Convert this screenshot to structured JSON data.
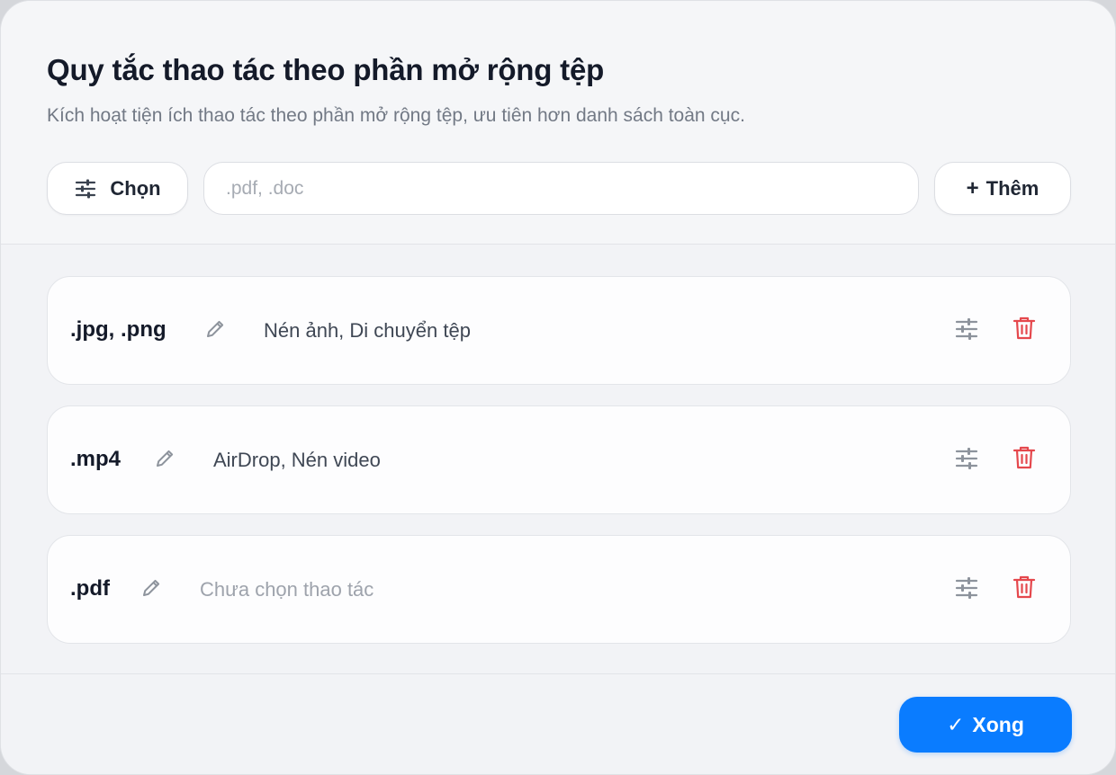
{
  "dialog": {
    "title": "Quy tắc thao tác theo phần mở rộng tệp",
    "subtitle": "Kích hoạt tiện ích thao tác theo phần mở rộng tệp, ưu tiên hơn danh sách toàn cục."
  },
  "toolbar": {
    "choose_label": "Chọn",
    "choose_icon": "sliders-icon",
    "input_value": "",
    "input_placeholder": ".pdf, .doc",
    "add_label": "Thêm",
    "add_icon": "plus-icon"
  },
  "rules": [
    {
      "extensions": ".jpg, .png",
      "actions": "Nén ảnh, Di chuyển tệp",
      "has_actions": true
    },
    {
      "extensions": ".mp4",
      "actions": "AirDrop, Nén video",
      "has_actions": true
    },
    {
      "extensions": ".pdf",
      "actions": "Chưa chọn thao tác",
      "has_actions": false
    }
  ],
  "rule_icons": {
    "edit": "pencil-icon",
    "configure": "sliders-icon",
    "delete": "trash-icon"
  },
  "footer": {
    "done_label": "Xong",
    "done_icon": "checkmark-icon"
  },
  "colors": {
    "accent": "#0a7cff",
    "delete": "#e5484d",
    "icon_gray": "#8d939c",
    "title": "#141a29",
    "muted": "#727985"
  }
}
